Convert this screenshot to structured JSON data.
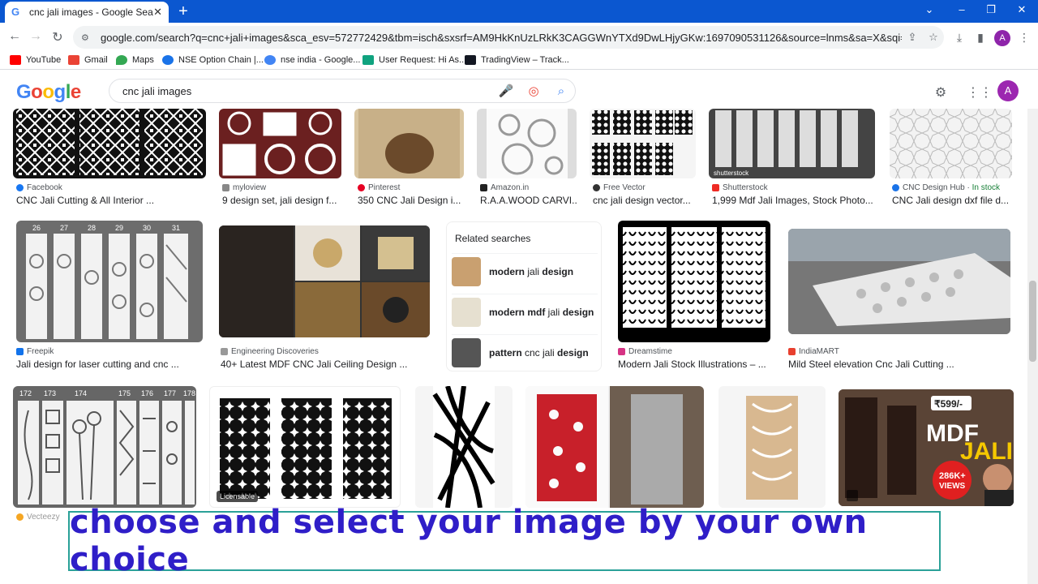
{
  "browser": {
    "tab_title": "cnc jali images - Google Search",
    "url": "google.com/search?q=cnc+jali+images&sca_esv=572772429&tbm=isch&sxsrf=AM9HkKnUzLRkK3CAGGWnYTXd9DwLHjyGKw:1697090531126&source=lnms&sa=X&sqi=2&ved=2ahUKEwil...",
    "avatar_letter": "A",
    "bookmarks": [
      {
        "label": "YouTube",
        "color": "#ff0000"
      },
      {
        "label": "Gmail",
        "color": "#ea4335"
      },
      {
        "label": "Maps",
        "color": "#34a853"
      },
      {
        "label": "NSE Option Chain |...",
        "color": "#1a73e8"
      },
      {
        "label": "nse india - Google...",
        "color": "#4285f4"
      },
      {
        "label": "User Request: Hi As...",
        "color": "#10a37f"
      },
      {
        "label": "TradingView – Track...",
        "color": "#131722"
      }
    ]
  },
  "google": {
    "logo": [
      "G",
      "o",
      "o",
      "g",
      "l",
      "e"
    ],
    "logo_colors": [
      "#4285f4",
      "#ea4335",
      "#fbbc05",
      "#4285f4",
      "#34a853",
      "#ea4335"
    ],
    "query": "cnc jali images",
    "avatar_letter": "A"
  },
  "results_row1": [
    {
      "source": "Facebook",
      "title": "CNC Jali Cutting & All Interior ...",
      "fav": "#1877f2"
    },
    {
      "source": "myloview",
      "title": "9 design set, jali design f...",
      "fav": "#888888"
    },
    {
      "source": "Pinterest",
      "title": "350 CNC Jali Design i...",
      "fav": "#e60023"
    },
    {
      "source": "Amazon.in",
      "title": "R.A.A.WOOD CARVI...",
      "fav": "#222222"
    },
    {
      "source": "Free Vector",
      "title": "cnc jali design vector...",
      "fav": "#333333"
    },
    {
      "source": "Shutterstock",
      "title": "1,999 Mdf Jali Images, Stock Photo...",
      "fav": "#ee2b24"
    },
    {
      "source": "CNC Design Hub",
      "source_extra": "In stock",
      "title": "CNC Jali design dxf file d...",
      "fav": "#1a73e8"
    }
  ],
  "results_row2": [
    {
      "source": "Freepik",
      "title": "Jali design for laser cutting and cnc ...",
      "fav": "#1273eb"
    },
    {
      "source": "Engineering Discoveries",
      "title": "40+ Latest MDF CNC Jali Ceiling Design ...",
      "fav": "#999999"
    },
    {
      "source": "Dreamstime",
      "title": "Modern Jali Stock Illustrations – ...",
      "fav": "#d63384"
    },
    {
      "source": "IndiaMART",
      "title": "Mild Steel elevation Cnc Jali Cutting ...",
      "fav": "#e8402f"
    }
  ],
  "row2_numbers": [
    "26",
    "27",
    "28",
    "29",
    "30",
    "31"
  ],
  "row3_numbers": [
    "172",
    "173",
    "174",
    "175",
    "176",
    "177",
    "178"
  ],
  "row3": {
    "licensable": "Licensable",
    "source_partial": "Vecteezy",
    "mdf_price": "₹599/-",
    "mdf_text": "MDF",
    "jali_text": "JALI",
    "views_count": "286K+",
    "views_label": "VIEWS"
  },
  "related_searches": {
    "header": "Related searches",
    "items": [
      {
        "bold": "modern",
        "normal": " jali ",
        "bold2": "design"
      },
      {
        "bold": "modern mdf",
        "normal": " jali ",
        "bold2": "design"
      },
      {
        "bold": "pattern",
        "normal": " cnc jali ",
        "bold2": "design"
      }
    ]
  },
  "watermark": "shutterstock",
  "caption": "choose and select your image by your own choice"
}
